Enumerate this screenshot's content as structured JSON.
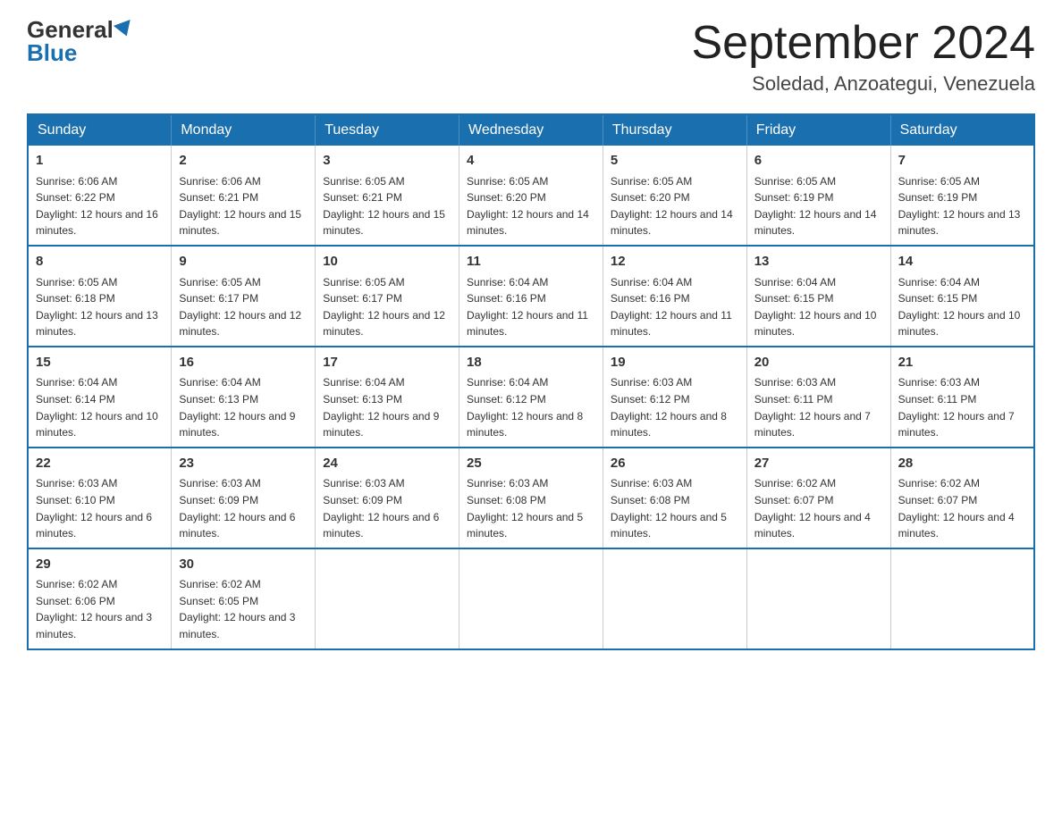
{
  "header": {
    "logo_general": "General",
    "logo_blue": "Blue",
    "month_title": "September 2024",
    "location": "Soledad, Anzoategui, Venezuela"
  },
  "days_of_week": [
    "Sunday",
    "Monday",
    "Tuesday",
    "Wednesday",
    "Thursday",
    "Friday",
    "Saturday"
  ],
  "weeks": [
    [
      {
        "day": "1",
        "sunrise": "Sunrise: 6:06 AM",
        "sunset": "Sunset: 6:22 PM",
        "daylight": "Daylight: 12 hours and 16 minutes."
      },
      {
        "day": "2",
        "sunrise": "Sunrise: 6:06 AM",
        "sunset": "Sunset: 6:21 PM",
        "daylight": "Daylight: 12 hours and 15 minutes."
      },
      {
        "day": "3",
        "sunrise": "Sunrise: 6:05 AM",
        "sunset": "Sunset: 6:21 PM",
        "daylight": "Daylight: 12 hours and 15 minutes."
      },
      {
        "day": "4",
        "sunrise": "Sunrise: 6:05 AM",
        "sunset": "Sunset: 6:20 PM",
        "daylight": "Daylight: 12 hours and 14 minutes."
      },
      {
        "day": "5",
        "sunrise": "Sunrise: 6:05 AM",
        "sunset": "Sunset: 6:20 PM",
        "daylight": "Daylight: 12 hours and 14 minutes."
      },
      {
        "day": "6",
        "sunrise": "Sunrise: 6:05 AM",
        "sunset": "Sunset: 6:19 PM",
        "daylight": "Daylight: 12 hours and 14 minutes."
      },
      {
        "day": "7",
        "sunrise": "Sunrise: 6:05 AM",
        "sunset": "Sunset: 6:19 PM",
        "daylight": "Daylight: 12 hours and 13 minutes."
      }
    ],
    [
      {
        "day": "8",
        "sunrise": "Sunrise: 6:05 AM",
        "sunset": "Sunset: 6:18 PM",
        "daylight": "Daylight: 12 hours and 13 minutes."
      },
      {
        "day": "9",
        "sunrise": "Sunrise: 6:05 AM",
        "sunset": "Sunset: 6:17 PM",
        "daylight": "Daylight: 12 hours and 12 minutes."
      },
      {
        "day": "10",
        "sunrise": "Sunrise: 6:05 AM",
        "sunset": "Sunset: 6:17 PM",
        "daylight": "Daylight: 12 hours and 12 minutes."
      },
      {
        "day": "11",
        "sunrise": "Sunrise: 6:04 AM",
        "sunset": "Sunset: 6:16 PM",
        "daylight": "Daylight: 12 hours and 11 minutes."
      },
      {
        "day": "12",
        "sunrise": "Sunrise: 6:04 AM",
        "sunset": "Sunset: 6:16 PM",
        "daylight": "Daylight: 12 hours and 11 minutes."
      },
      {
        "day": "13",
        "sunrise": "Sunrise: 6:04 AM",
        "sunset": "Sunset: 6:15 PM",
        "daylight": "Daylight: 12 hours and 10 minutes."
      },
      {
        "day": "14",
        "sunrise": "Sunrise: 6:04 AM",
        "sunset": "Sunset: 6:15 PM",
        "daylight": "Daylight: 12 hours and 10 minutes."
      }
    ],
    [
      {
        "day": "15",
        "sunrise": "Sunrise: 6:04 AM",
        "sunset": "Sunset: 6:14 PM",
        "daylight": "Daylight: 12 hours and 10 minutes."
      },
      {
        "day": "16",
        "sunrise": "Sunrise: 6:04 AM",
        "sunset": "Sunset: 6:13 PM",
        "daylight": "Daylight: 12 hours and 9 minutes."
      },
      {
        "day": "17",
        "sunrise": "Sunrise: 6:04 AM",
        "sunset": "Sunset: 6:13 PM",
        "daylight": "Daylight: 12 hours and 9 minutes."
      },
      {
        "day": "18",
        "sunrise": "Sunrise: 6:04 AM",
        "sunset": "Sunset: 6:12 PM",
        "daylight": "Daylight: 12 hours and 8 minutes."
      },
      {
        "day": "19",
        "sunrise": "Sunrise: 6:03 AM",
        "sunset": "Sunset: 6:12 PM",
        "daylight": "Daylight: 12 hours and 8 minutes."
      },
      {
        "day": "20",
        "sunrise": "Sunrise: 6:03 AM",
        "sunset": "Sunset: 6:11 PM",
        "daylight": "Daylight: 12 hours and 7 minutes."
      },
      {
        "day": "21",
        "sunrise": "Sunrise: 6:03 AM",
        "sunset": "Sunset: 6:11 PM",
        "daylight": "Daylight: 12 hours and 7 minutes."
      }
    ],
    [
      {
        "day": "22",
        "sunrise": "Sunrise: 6:03 AM",
        "sunset": "Sunset: 6:10 PM",
        "daylight": "Daylight: 12 hours and 6 minutes."
      },
      {
        "day": "23",
        "sunrise": "Sunrise: 6:03 AM",
        "sunset": "Sunset: 6:09 PM",
        "daylight": "Daylight: 12 hours and 6 minutes."
      },
      {
        "day": "24",
        "sunrise": "Sunrise: 6:03 AM",
        "sunset": "Sunset: 6:09 PM",
        "daylight": "Daylight: 12 hours and 6 minutes."
      },
      {
        "day": "25",
        "sunrise": "Sunrise: 6:03 AM",
        "sunset": "Sunset: 6:08 PM",
        "daylight": "Daylight: 12 hours and 5 minutes."
      },
      {
        "day": "26",
        "sunrise": "Sunrise: 6:03 AM",
        "sunset": "Sunset: 6:08 PM",
        "daylight": "Daylight: 12 hours and 5 minutes."
      },
      {
        "day": "27",
        "sunrise": "Sunrise: 6:02 AM",
        "sunset": "Sunset: 6:07 PM",
        "daylight": "Daylight: 12 hours and 4 minutes."
      },
      {
        "day": "28",
        "sunrise": "Sunrise: 6:02 AM",
        "sunset": "Sunset: 6:07 PM",
        "daylight": "Daylight: 12 hours and 4 minutes."
      }
    ],
    [
      {
        "day": "29",
        "sunrise": "Sunrise: 6:02 AM",
        "sunset": "Sunset: 6:06 PM",
        "daylight": "Daylight: 12 hours and 3 minutes."
      },
      {
        "day": "30",
        "sunrise": "Sunrise: 6:02 AM",
        "sunset": "Sunset: 6:05 PM",
        "daylight": "Daylight: 12 hours and 3 minutes."
      },
      null,
      null,
      null,
      null,
      null
    ]
  ]
}
